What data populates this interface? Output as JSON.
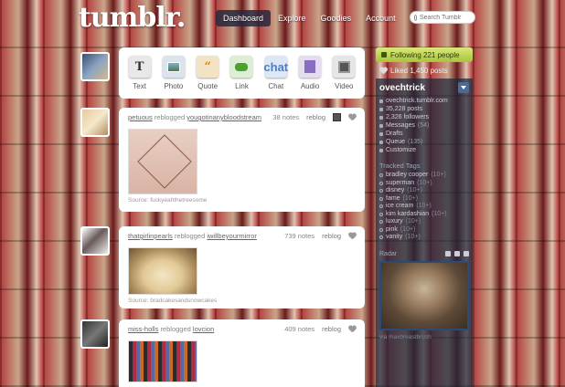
{
  "header": {
    "logo": "tumblr.",
    "nav": [
      {
        "label": "Dashboard",
        "active": true
      },
      {
        "label": "Explore",
        "active": false
      },
      {
        "label": "Goodies",
        "active": false
      },
      {
        "label": "Account",
        "active": false
      }
    ],
    "search_placeholder": "Search Tumblr"
  },
  "post_types": [
    {
      "label": "Text",
      "icon": "text-icon",
      "glyph": "T"
    },
    {
      "label": "Photo",
      "icon": "photo-icon",
      "glyph": ""
    },
    {
      "label": "Quote",
      "icon": "quote-icon",
      "glyph": "“"
    },
    {
      "label": "Link",
      "icon": "link-icon",
      "glyph": ""
    },
    {
      "label": "Chat",
      "icon": "chat-icon",
      "glyph": "chat"
    },
    {
      "label": "Audio",
      "icon": "audio-icon",
      "glyph": ""
    },
    {
      "label": "Video",
      "icon": "video-icon",
      "glyph": ""
    }
  ],
  "posts": [
    {
      "author": "petuous",
      "action": "reblogged",
      "source": "yougotinanybloodstream",
      "notes": "38 notes",
      "reblog": "reblog",
      "caption": "Source: fuckyeahthetreesome"
    },
    {
      "author": "thatgirlinpearls",
      "action": "reblogged",
      "source": "iwillbeyourmirror",
      "notes": "739 notes",
      "reblog": "reblog",
      "caption": "Source: bradcakesandsnowcakes"
    },
    {
      "author": "miss-holls",
      "action": "reblogged",
      "source": "lovcion",
      "notes": "409 notes",
      "reblog": "reblog",
      "caption": ""
    }
  ],
  "sidebar": {
    "following": "Following 221 people",
    "liked": "Liked 1,450 posts",
    "blog_name": "ovechtrick",
    "stats": [
      {
        "label": "ovechtrick.tumblr.com",
        "count": ""
      },
      {
        "label": "35,228 posts",
        "count": ""
      },
      {
        "label": "2,326 followers",
        "count": ""
      },
      {
        "label": "Messages",
        "count": "(54)"
      },
      {
        "label": "Drafts",
        "count": ""
      },
      {
        "label": "Queue",
        "count": "(135)"
      },
      {
        "label": "Customize",
        "count": ""
      }
    ],
    "tracked_tags_title": "Tracked Tags",
    "tracked_tags": [
      {
        "tag": "bradley cooper",
        "count": "(10+)"
      },
      {
        "tag": "superman",
        "count": "(10+)"
      },
      {
        "tag": "disney",
        "count": "(10+)"
      },
      {
        "tag": "fame",
        "count": "(10+)"
      },
      {
        "tag": "ice cream",
        "count": "(10+)"
      },
      {
        "tag": "kim kardashian",
        "count": "(10+)"
      },
      {
        "tag": "luxury",
        "count": "(10+)"
      },
      {
        "tag": "pink",
        "count": "(10+)"
      },
      {
        "tag": "vanity",
        "count": "(10+)"
      }
    ],
    "radar_title": "Radar",
    "radar_caption": "via maxbreastbrush"
  }
}
